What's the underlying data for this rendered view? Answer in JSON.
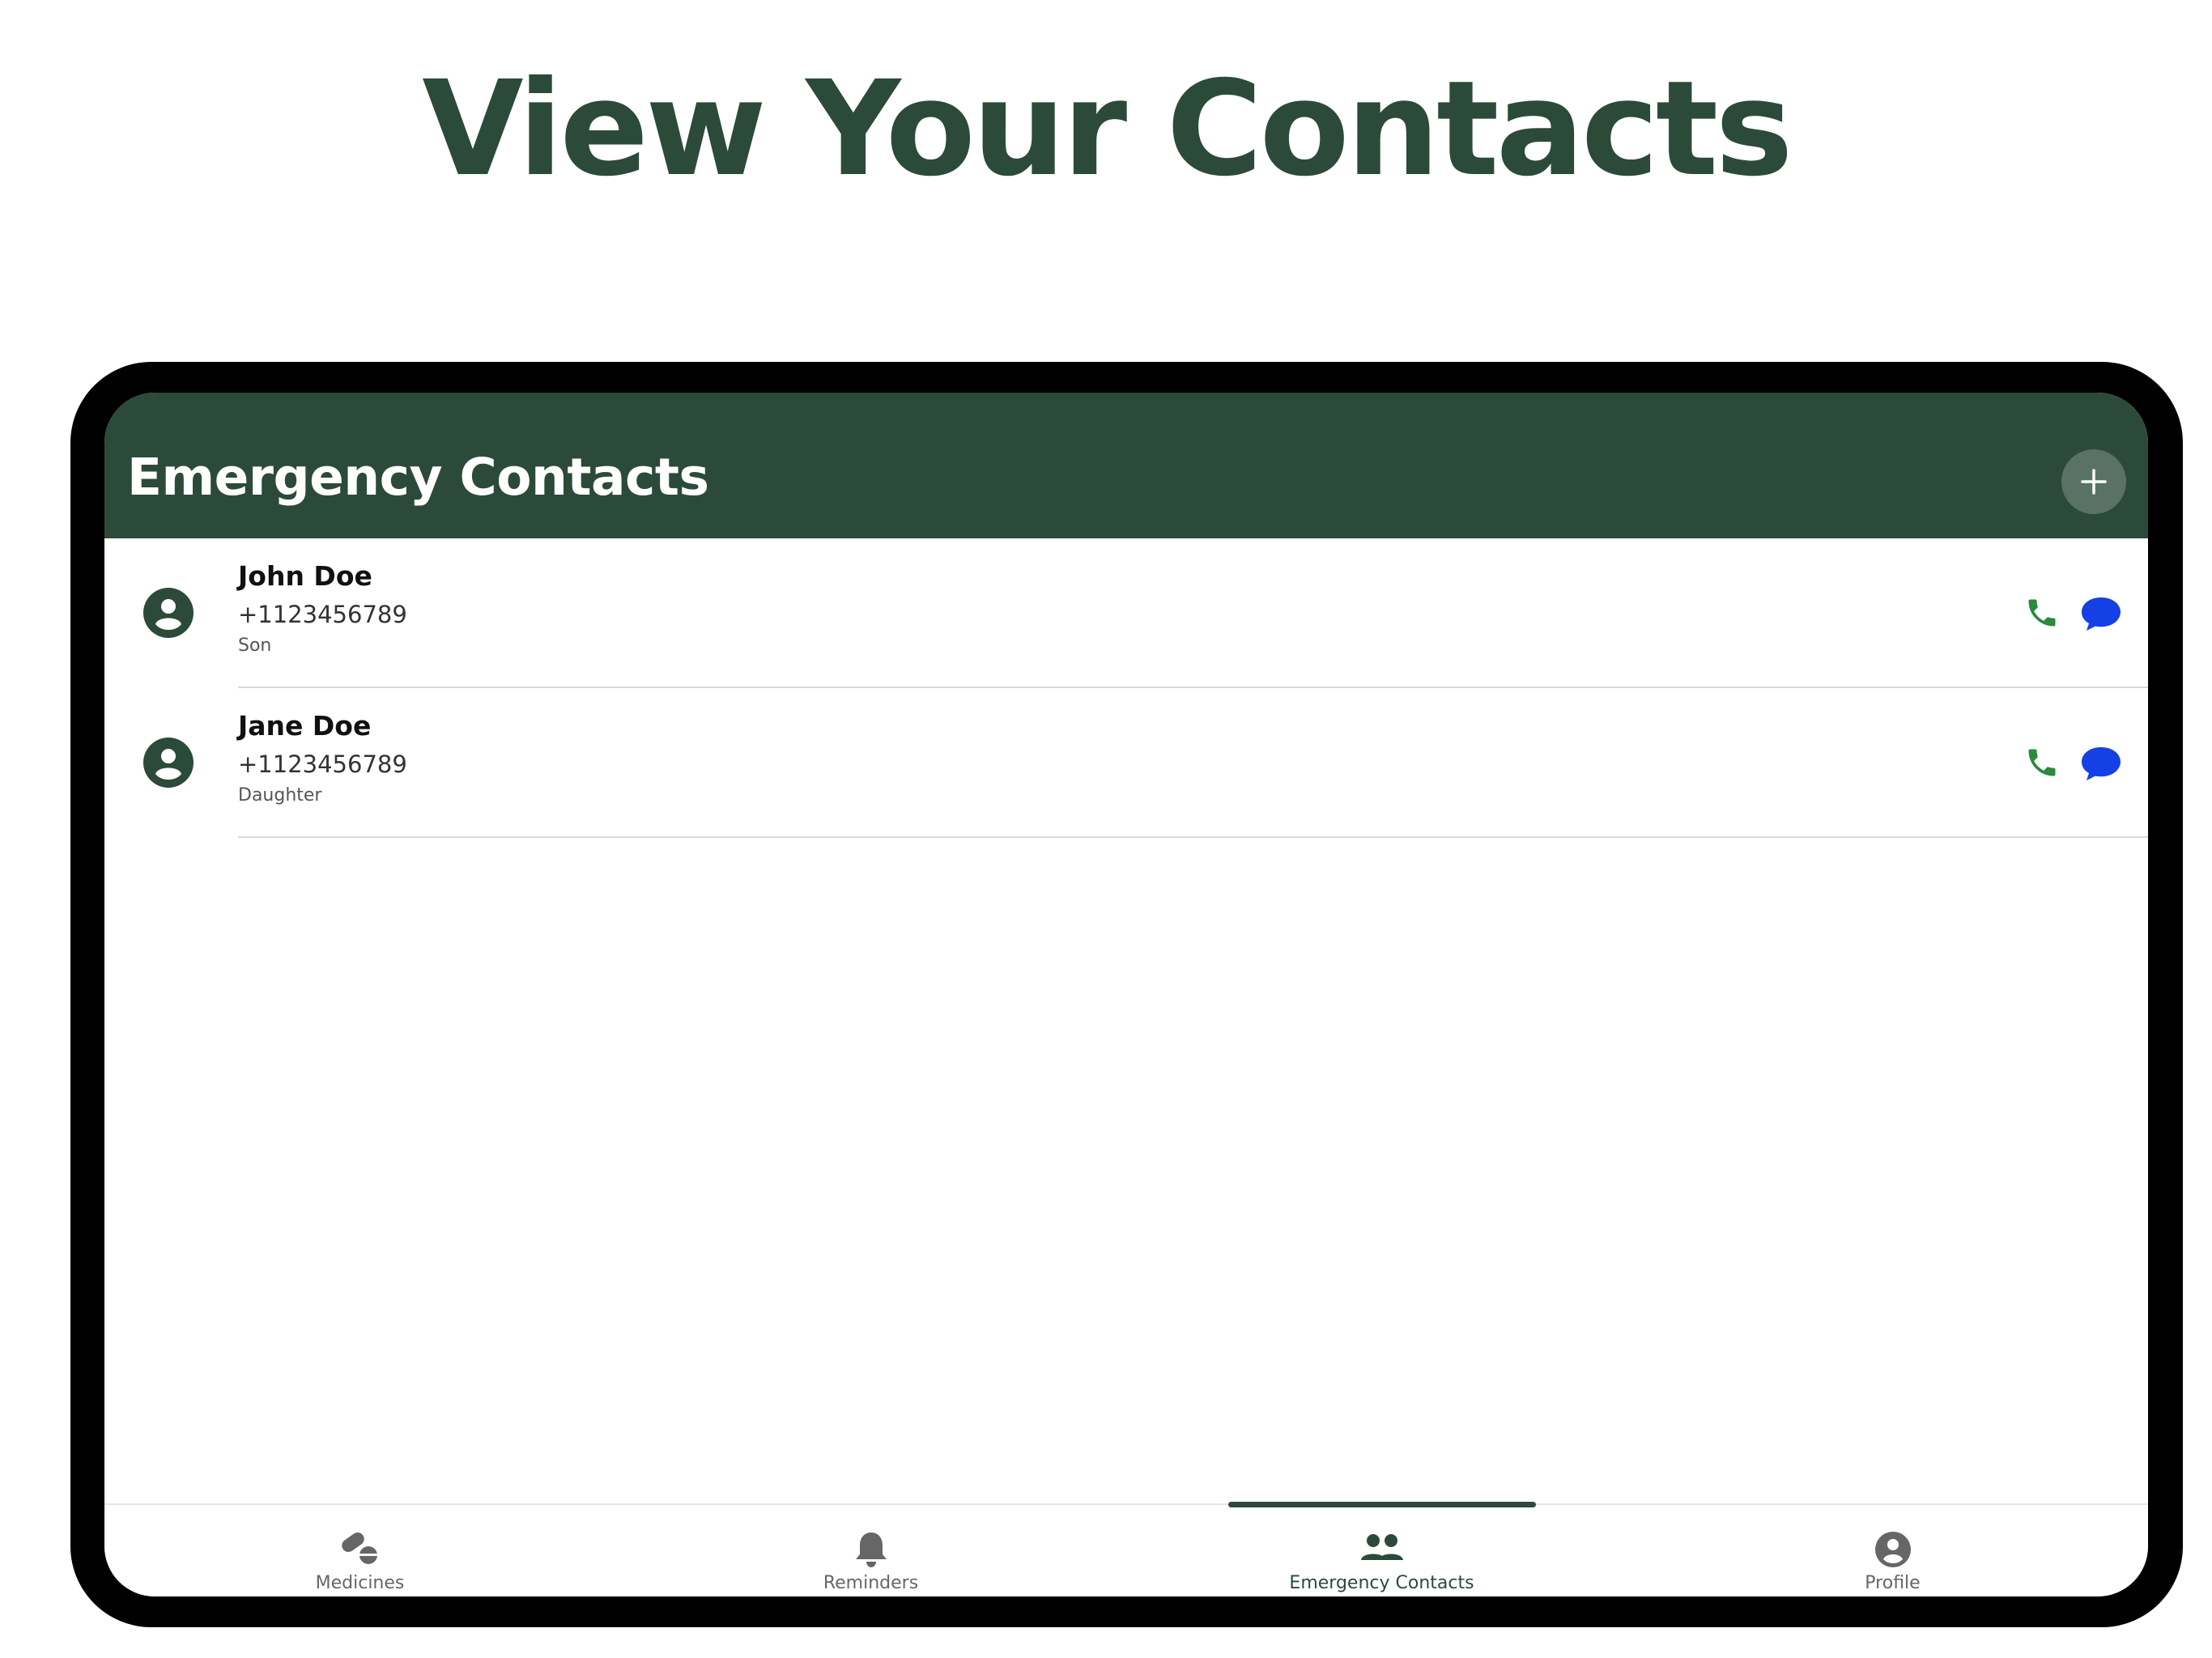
{
  "promo": {
    "title": "View Your Contacts"
  },
  "colors": {
    "brand_dark_green": "#2c4a3a",
    "call_green": "#2a8a3e",
    "message_blue": "#1440e6",
    "device_frame": "#000000",
    "tab_inactive": "#666666"
  },
  "header": {
    "title": "Emergency Contacts",
    "add_icon": "plus-icon"
  },
  "contacts": [
    {
      "name": "John Doe",
      "phone": "+1123456789",
      "relation": "Son"
    },
    {
      "name": "Jane Doe",
      "phone": "+1123456789",
      "relation": "Daughter"
    }
  ],
  "contact_icons": {
    "avatar": "person-circle-icon",
    "call": "phone-icon",
    "message": "chat-bubble-icon"
  },
  "tabs": [
    {
      "label": "Medicines",
      "icon": "pills-icon",
      "active": false
    },
    {
      "label": "Reminders",
      "icon": "bell-icon",
      "active": false
    },
    {
      "label": "Emergency Contacts",
      "icon": "people-icon",
      "active": true
    },
    {
      "label": "Profile",
      "icon": "person-circle-icon",
      "active": false
    }
  ]
}
